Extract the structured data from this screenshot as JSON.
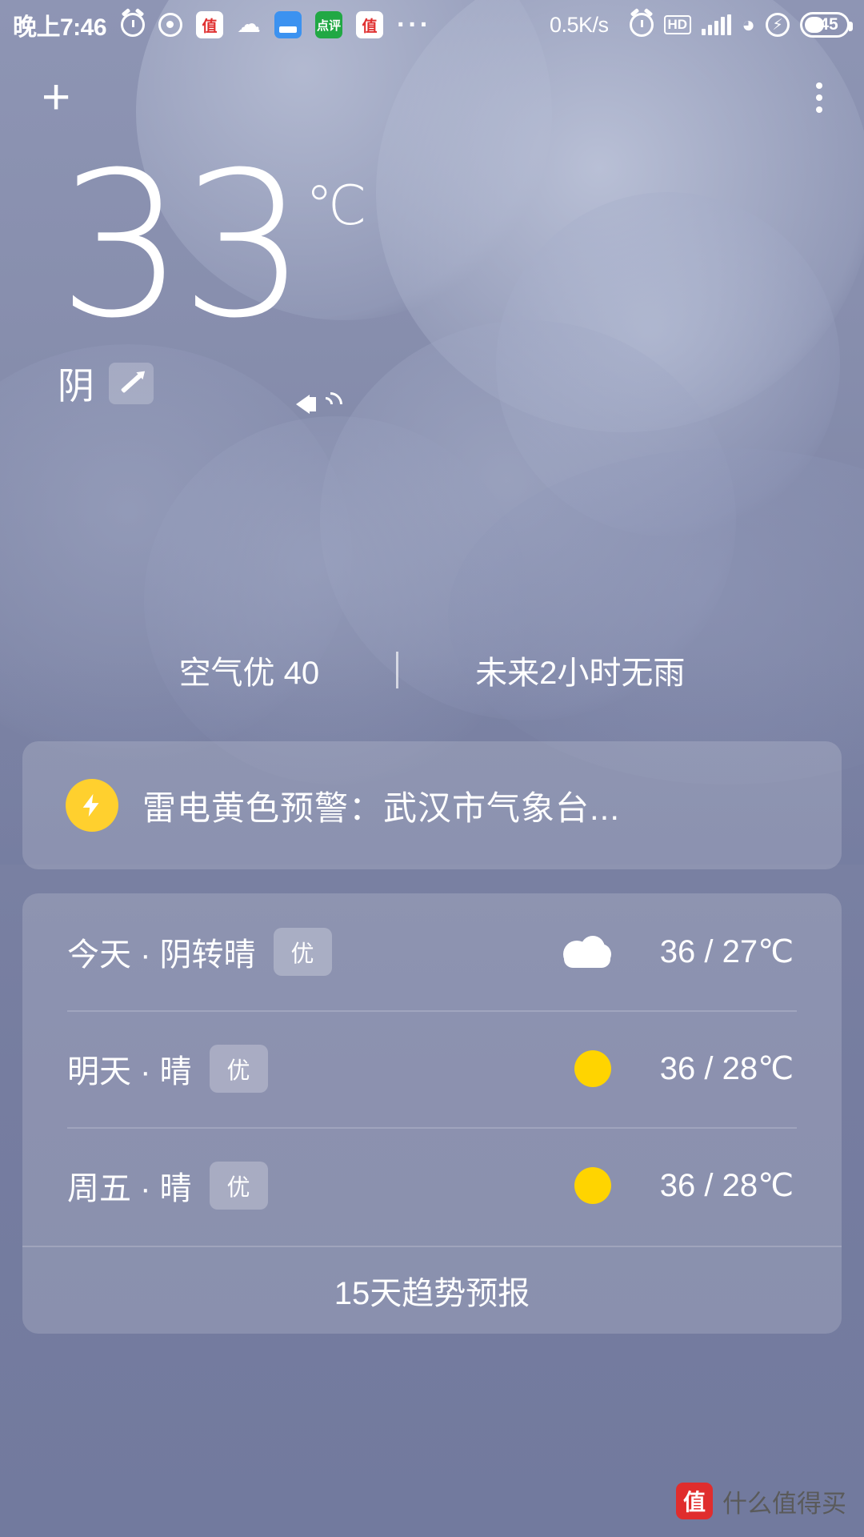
{
  "statusbar": {
    "time": "晚上7:46",
    "icons": [
      "alarm-clock-icon",
      "camera-dot-icon",
      "zhi-app-icon",
      "cloud-app-icon",
      "blue-app-icon",
      "green-app-icon",
      "zhi-app-icon-2",
      "more-dots-icon"
    ],
    "zhi_label": "值",
    "green_label": "点评",
    "network_speed": "0.5K/s",
    "bluetooth": "bluetooth-icon",
    "alarm2": "alarm-icon",
    "hd_label": "HD",
    "signal": "signal-bars-icon",
    "wifi": "wifi-icon",
    "flash": "flash-icon",
    "battery_level": "45"
  },
  "topbar": {
    "add_label": "+",
    "menu_label": "more-vertical-icon"
  },
  "current": {
    "temperature": "33",
    "unit": "℃",
    "condition": "阴",
    "speaker_icon": "volume-icon",
    "edit_icon": "pencil-icon"
  },
  "summary": {
    "air_quality": "空气优 40",
    "rain_forecast": "未来2小时无雨"
  },
  "alert": {
    "icon": "lightning-bolt-icon",
    "text": "雷电黄色预警：武汉市气象台..."
  },
  "forecast": {
    "rows": [
      {
        "label": "今天 · 阴转晴",
        "aqi": "优",
        "icon": "cloud-icon",
        "temp": "36 / 27℃"
      },
      {
        "label": "明天 · 晴",
        "aqi": "优",
        "icon": "sun-icon",
        "temp": "36 / 28℃"
      },
      {
        "label": "周五 · 晴",
        "aqi": "优",
        "icon": "sun-icon",
        "temp": "36 / 28℃"
      }
    ],
    "trend_label": "15天趋势预报"
  },
  "watermark": {
    "logo": "值",
    "text": "什么值得买"
  },
  "colors": {
    "background_top": "#8e95b4",
    "background_bottom": "#727a9e",
    "accent_yellow": "#ffd02e",
    "sun_yellow": "#ffd400",
    "card_bg": "rgba(255,255,255,0.16)"
  }
}
